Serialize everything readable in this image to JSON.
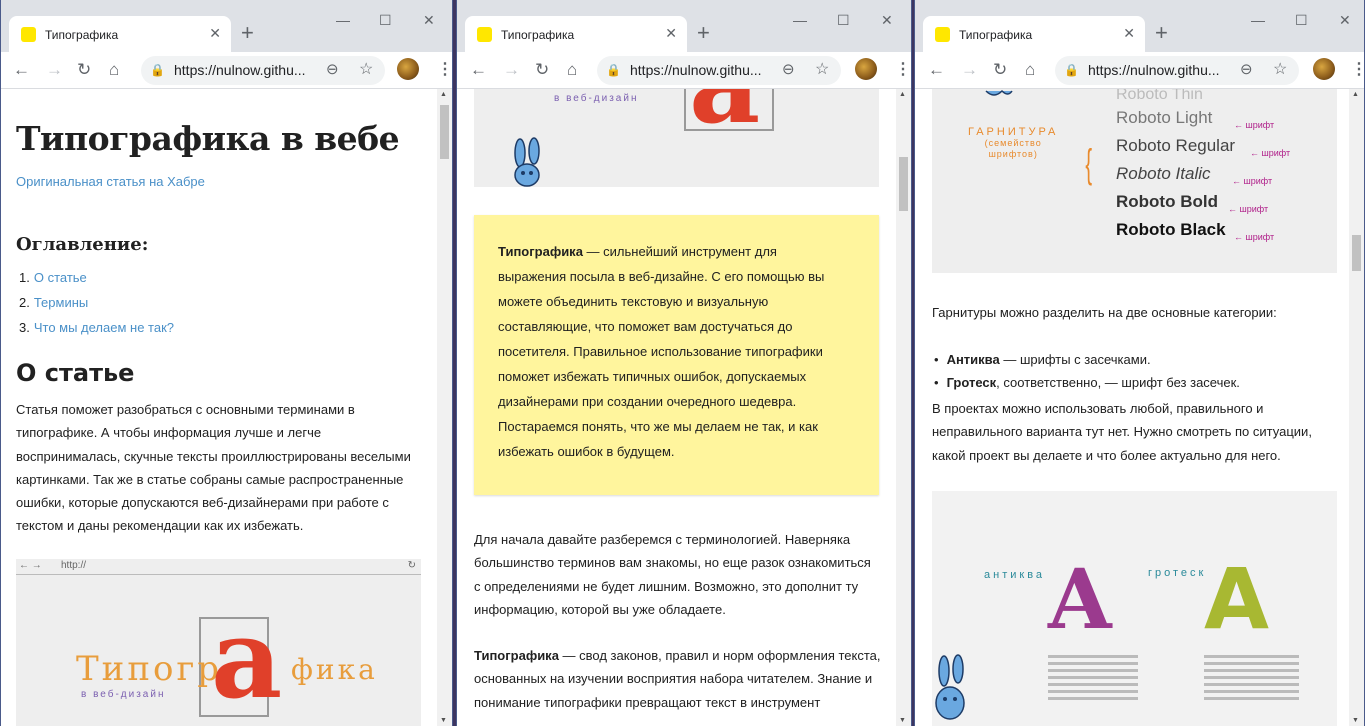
{
  "tab_title": "Типографика",
  "url_display": "https://nulnow.githu...",
  "window1": {
    "h1": "Типографика в вебе",
    "source_link": "Оригинальная статья на Хабре",
    "toc_title": "Оглавление:",
    "toc": [
      {
        "num": "1.",
        "label": "О статье"
      },
      {
        "num": "2.",
        "label": "Термины"
      },
      {
        "num": "3.",
        "label": "Что мы делаем не так?"
      }
    ],
    "section_title": "О статье",
    "para": [
      "Статья поможет разобраться с основными терминами в",
      "типографике. А чтобы информация лучше и легче",
      "воспринималась, скучные тексты проиллюстрированы веселыми",
      "картинками. Так же в статье собраны самые распространенные",
      "ошибки, которые допускаются веб-дизайнерами при работе с",
      "текстом и даны рекомендации как их избежать."
    ],
    "illus_url": "http://",
    "illus_word1": "Типогр",
    "illus_a": "а",
    "illus_word2": "фика",
    "illus_caption": "в веб-дизайн"
  },
  "window2": {
    "illus_caption": "в веб-дизайн",
    "note_term": "Типографика",
    "note_lines": [
      " — сильнейший инструмент для",
      "выражения посыла в веб-дизайне. С его помощью вы",
      "можете объединить текстовую и визуальную",
      "составляющие, что поможет вам достучаться до",
      "посетителя. Правильное использование типографики",
      "поможет избежать типичных ошибок, допускаемых",
      "дизайнерами при создании очередного шедевра.",
      "Постараемся понять, что же мы делаем не так, и как",
      "избежать ошибок в будущем."
    ],
    "para1": [
      "Для начала давайте разберемся с терминологией. Наверняка",
      "большинство терминов вам знакомы, но еще разок ознакомиться",
      "с определениями не будет лишним. Возможно, это дополнит ту",
      "информацию, которой вы уже обладаете."
    ],
    "para2_term": "Типографика",
    "para2_lines": [
      " — свод законов, правил и норм оформления текста,",
      "основанных на изучении восприятия набора читателем. Знание и",
      "понимание типографики превращают текст в инструмент"
    ]
  },
  "window3": {
    "fonts": [
      "Roboto Thin",
      "Roboto Light",
      "Roboto Regular",
      "Roboto Italic",
      "Roboto Bold",
      "Roboto Black"
    ],
    "font_arrow_label": "← шрифт",
    "family_label": [
      "ГАРНИТУРА",
      "(семейство",
      "шрифтов)"
    ],
    "intro": "Гарнитуры можно разделить на две основные категории:",
    "bullets": [
      {
        "term": "Антиква",
        "rest": " — шрифты с засечками."
      },
      {
        "term": "Гротеск",
        "rest": ", соответственно, — шрифт без засечек."
      }
    ],
    "para": [
      "В проектах можно использовать любой, правильного и",
      "неправильного варианта тут нет. Нужно смотреть по ситуации,",
      "какой проект вы делаете и что более актуально для него."
    ],
    "antiqua_label": "антиква",
    "grotesque_label": "гротеск",
    "letter": "A"
  }
}
